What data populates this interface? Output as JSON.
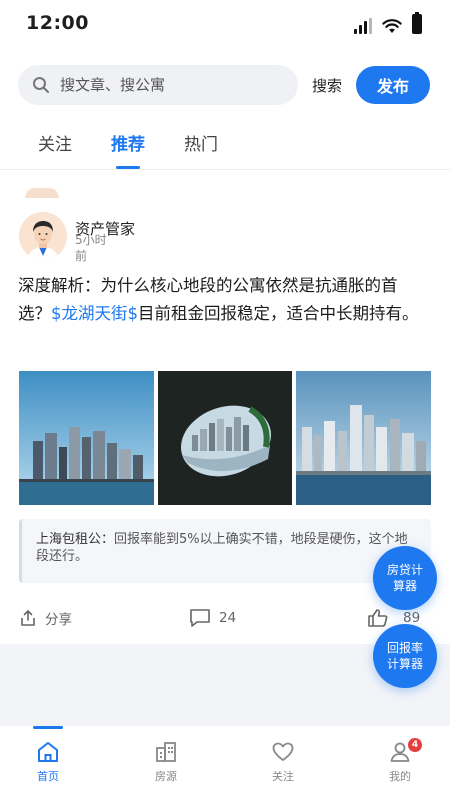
{
  "status_bar": {
    "time": "12:00"
  },
  "search": {
    "placeholder": "搜文章、搜公寓",
    "search_label": "搜索",
    "publish_label": "发布"
  },
  "tabs": [
    {
      "label": "关注"
    },
    {
      "label": "推荐"
    },
    {
      "label": "热门"
    }
  ],
  "post": {
    "author": "资产管家",
    "time": "5小时前",
    "text_before": "深度解析：为什么核心地段的公寓依然是抗通胀的首选？",
    "tag": "$龙湖天街$",
    "text_after": "目前租金回报稳定，适合中长期持有。",
    "comment": {
      "author": "上海包租公：",
      "text": "回报率能到5%以上确实不错，地段是硬伤，这个地段还行。"
    },
    "actions": {
      "share_label": "分享",
      "comments": "24",
      "likes": "89"
    }
  },
  "floating_buttons": {
    "mortgage": "房贷计算器",
    "yield": "回报率计算器"
  },
  "bottom_nav": [
    {
      "label": "首页"
    },
    {
      "label": "房源"
    },
    {
      "label": "关注"
    },
    {
      "label": "我的",
      "badge": "4"
    }
  ],
  "colors": {
    "accent": "#1e78f0",
    "badge": "#e63d3d"
  }
}
